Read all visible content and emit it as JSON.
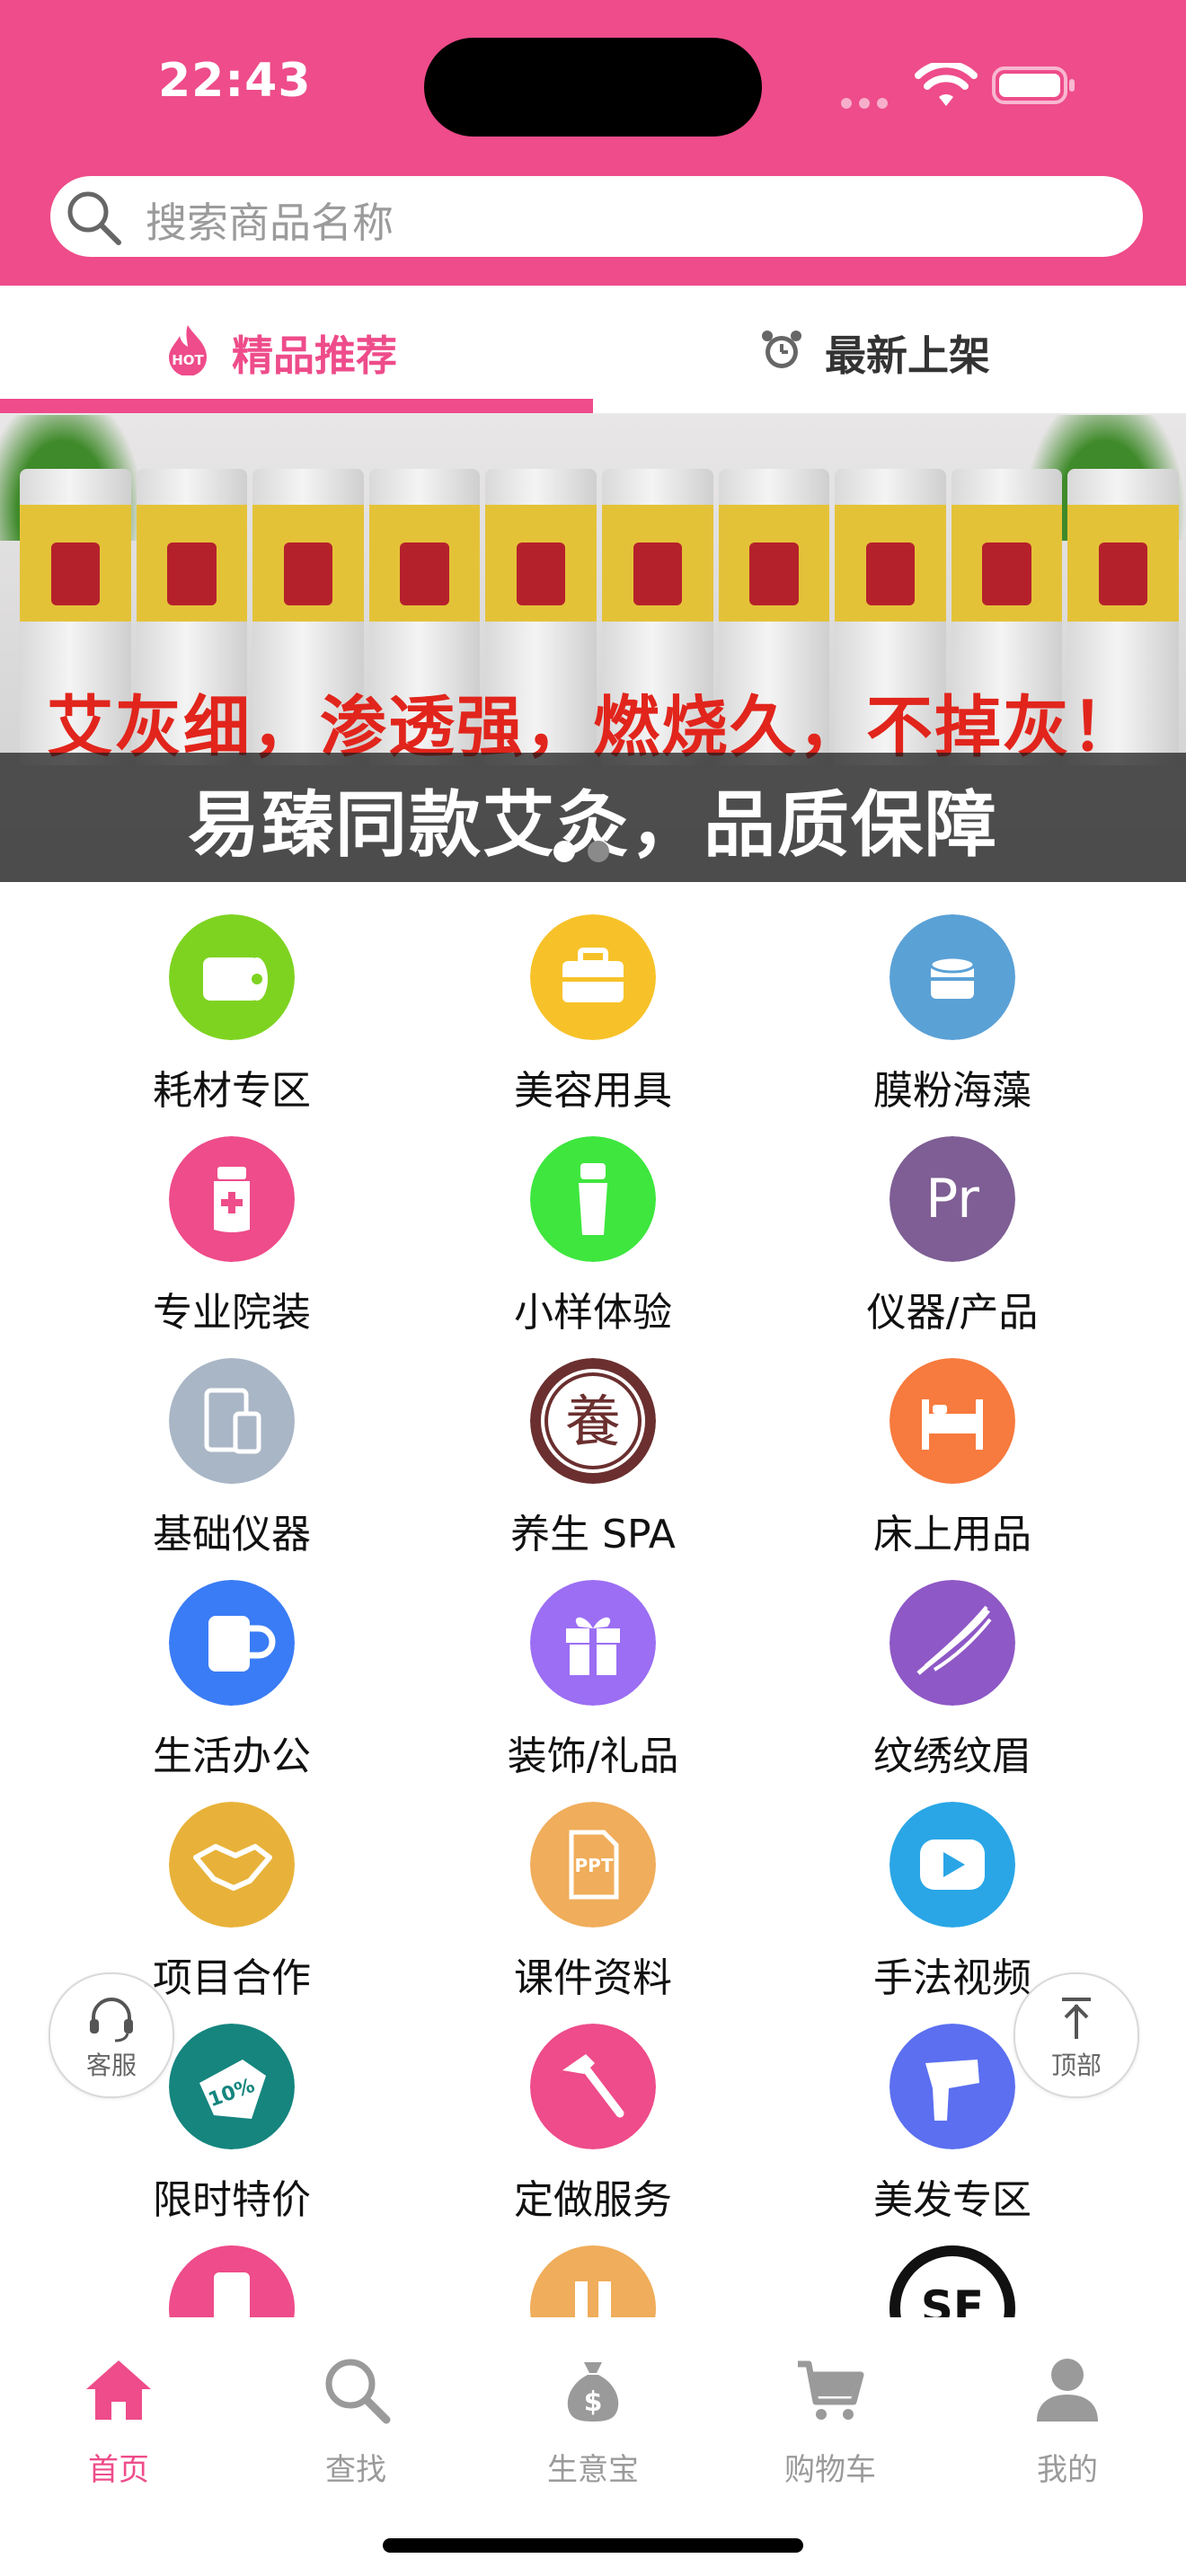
{
  "status_bar": {
    "time": "22:43"
  },
  "search": {
    "placeholder": "搜索商品名称"
  },
  "tabs": [
    {
      "label": "精品推荐",
      "icon": "hot-icon",
      "active": true
    },
    {
      "label": "最新上架",
      "icon": "clock-icon",
      "active": false
    }
  ],
  "banner": {
    "slogan": "艾灰细，渗透强，燃烧久，不掉灰！",
    "caption": "易臻同款艾灸，品质保障",
    "page_count": 2,
    "current_page": 1
  },
  "categories": [
    {
      "label": "耗材专区",
      "icon": "tissue-roll-icon",
      "color": "#7ed321"
    },
    {
      "label": "美容用具",
      "icon": "toolbox-icon",
      "color": "#f7c229"
    },
    {
      "label": "膜粉海藻",
      "icon": "jar-icon",
      "color": "#5aa1d6"
    },
    {
      "label": "专业院装",
      "icon": "medicine-bottle-icon",
      "color": "#ee4c8a"
    },
    {
      "label": "小样体验",
      "icon": "sample-tube-icon",
      "color": "#3ee63e"
    },
    {
      "label": "仪器/产品",
      "icon": "pr-icon",
      "color": "#7e5e94",
      "icon_text": "Pr"
    },
    {
      "label": "基础仪器",
      "icon": "devices-icon",
      "color": "#a9b6c6"
    },
    {
      "label": "养生 SPA",
      "icon": "yang-seal-icon",
      "color": "#6b2f2f",
      "icon_text": "養"
    },
    {
      "label": "床上用品",
      "icon": "bed-icon",
      "color": "#f77a3e"
    },
    {
      "label": "生活办公",
      "icon": "mug-icon",
      "color": "#3a7cf5"
    },
    {
      "label": "装饰/礼品",
      "icon": "gift-icon",
      "color": "#9b6ef3"
    },
    {
      "label": "纹绣纹眉",
      "icon": "feather-icon",
      "color": "#8e58c6"
    },
    {
      "label": "项目合作",
      "icon": "handshake-icon",
      "color": "#e8b23a"
    },
    {
      "label": "课件资料",
      "icon": "ppt-icon",
      "color": "#f0ad5b",
      "icon_text": "PPT"
    },
    {
      "label": "手法视频",
      "icon": "play-icon",
      "color": "#2aa6e6"
    },
    {
      "label": "限时特价",
      "icon": "discount-tag-icon",
      "color": "#15857e",
      "icon_text": "10%"
    },
    {
      "label": "定做服务",
      "icon": "hammer-icon",
      "color": "#ee4c8a"
    },
    {
      "label": "美发专区",
      "icon": "hair-dryer-icon",
      "color": "#5b6ff0"
    }
  ],
  "floating": {
    "service_label": "客服",
    "top_label": "顶部"
  },
  "bottom_nav": [
    {
      "label": "首页",
      "icon": "home-icon",
      "active": true
    },
    {
      "label": "查找",
      "icon": "search-icon",
      "active": false
    },
    {
      "label": "生意宝",
      "icon": "money-bag-icon",
      "active": false
    },
    {
      "label": "购物车",
      "icon": "cart-icon",
      "active": false
    },
    {
      "label": "我的",
      "icon": "user-icon",
      "active": false
    }
  ],
  "colors": {
    "brand": "#ee4c8a",
    "inactive": "#9a9a9a"
  }
}
